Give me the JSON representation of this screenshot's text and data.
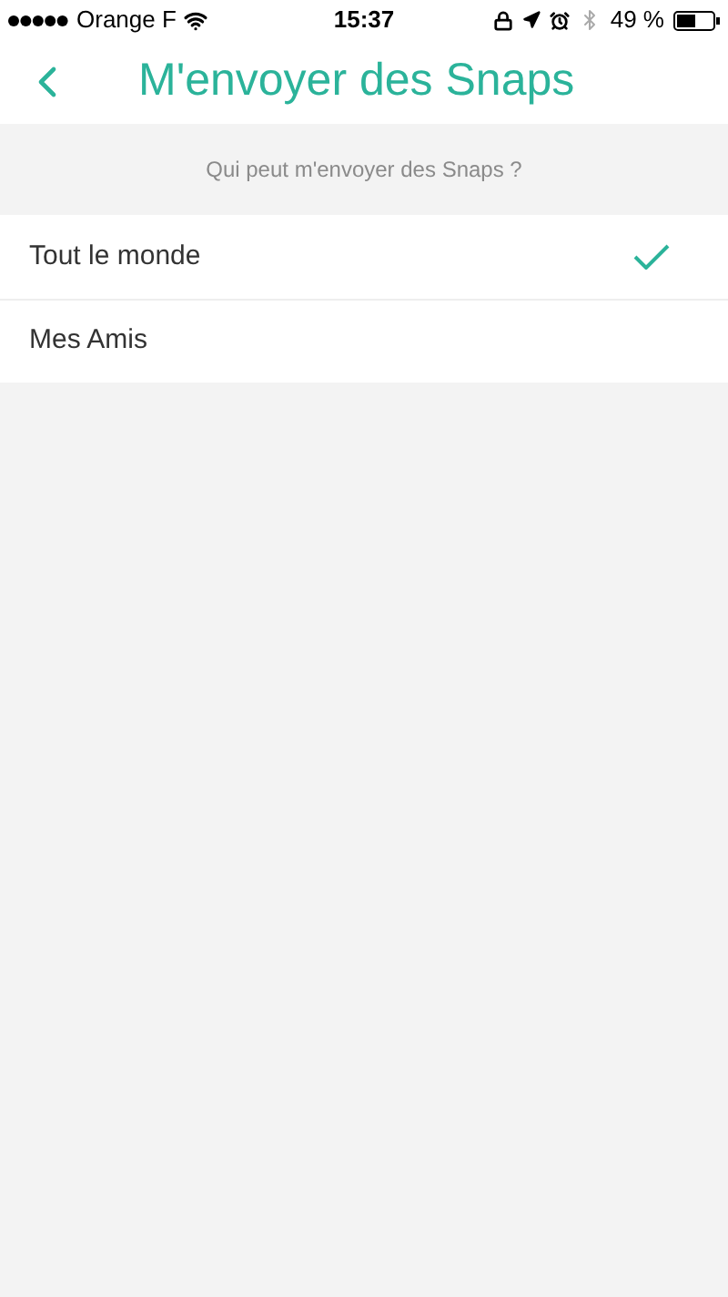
{
  "status_bar": {
    "carrier": "Orange F",
    "time": "15:37",
    "battery": "49 %"
  },
  "nav": {
    "title": "M'envoyer des Snaps"
  },
  "section": {
    "header": "Qui peut m'envoyer des Snaps ?"
  },
  "options": [
    {
      "label": "Tout le monde",
      "selected": true
    },
    {
      "label": "Mes Amis",
      "selected": false
    }
  ]
}
